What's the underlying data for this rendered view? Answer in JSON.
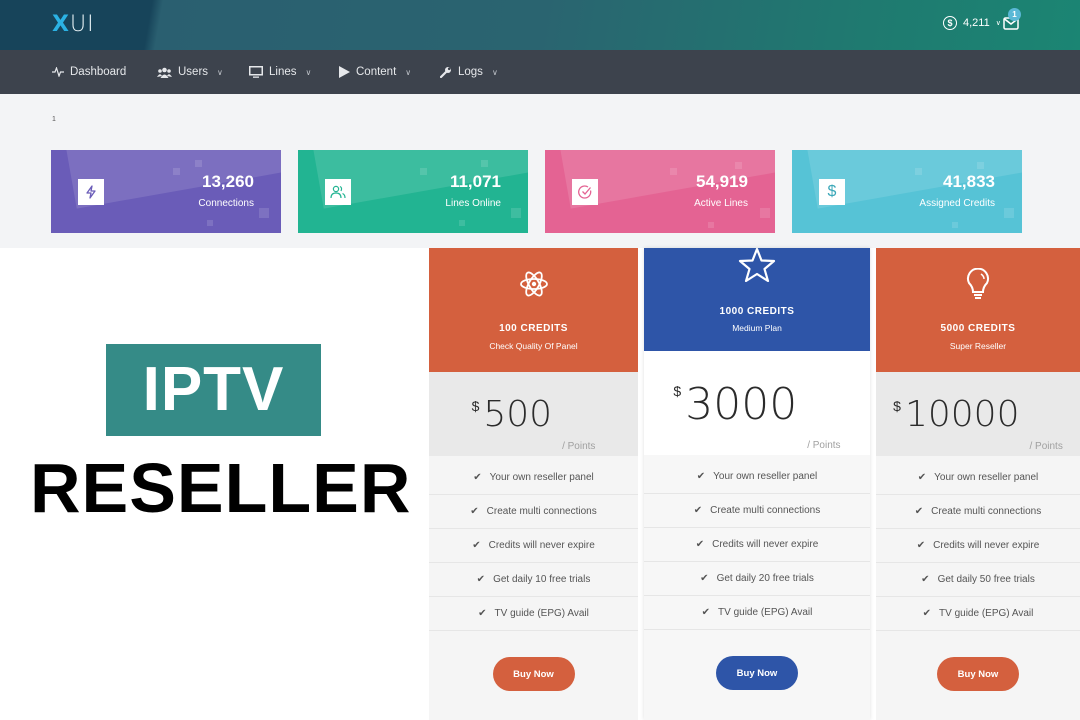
{
  "colors": {
    "orange": "#d4603e",
    "blue": "#2e55a8",
    "purple": "#6a5cb8",
    "green": "#22b492",
    "pink": "#e46393",
    "cyan": "#56c3d6",
    "teal_banner": "#358b87",
    "nav_bg": "#3d434d"
  },
  "header": {
    "logo_x": "X",
    "logo_rest": "UI",
    "credits_value": "4,211",
    "mail_badge": "1"
  },
  "nav": {
    "items": [
      {
        "label": "Dashboard",
        "icon": "activity-icon",
        "has_dropdown": false
      },
      {
        "label": "Users",
        "icon": "users-icon",
        "has_dropdown": true
      },
      {
        "label": "Lines",
        "icon": "monitor-icon",
        "has_dropdown": true
      },
      {
        "label": "Content",
        "icon": "play-icon",
        "has_dropdown": true
      },
      {
        "label": "Logs",
        "icon": "wrench-icon",
        "has_dropdown": true
      }
    ]
  },
  "breadcrumb_mark": "1",
  "stats": [
    {
      "value": "13,260",
      "label": "Connections",
      "icon": "lightning-icon"
    },
    {
      "value": "11,071",
      "label": "Lines Online",
      "icon": "users-icon"
    },
    {
      "value": "54,919",
      "label": "Active Lines",
      "icon": "check-circle-icon"
    },
    {
      "value": "41,833",
      "label": "Assigned Credits",
      "icon": "dollar-icon"
    }
  ],
  "banner": {
    "line1": "IPTV",
    "line2": "RESELLER"
  },
  "plans": [
    {
      "title": "100 CREDITS",
      "subtitle": "Check Quality Of Panel",
      "icon": "atom-icon",
      "currency": "$",
      "price": "500",
      "per": "/ Points",
      "features": [
        "Your own reseller panel",
        "Create multi connections",
        "Credits will never expire",
        "Get daily 10 free trials",
        "TV guide (EPG) Avail"
      ],
      "button": "Buy Now"
    },
    {
      "title": "1000 CREDITS",
      "subtitle": "Medium Plan",
      "icon": "star-icon",
      "currency": "$",
      "price": "3000",
      "per": "/ Points",
      "features": [
        "Your own reseller panel",
        "Create multi connections",
        "Credits will never expire",
        "Get daily 20 free trials",
        "TV guide (EPG) Avail"
      ],
      "button": "Buy Now"
    },
    {
      "title": "5000 CREDITS",
      "subtitle": "Super Reseller",
      "icon": "lightbulb-icon",
      "currency": "$",
      "price": "10000",
      "per": "/ Points",
      "features": [
        "Your own reseller panel",
        "Create multi connections",
        "Credits will never expire",
        "Get daily 50 free trials",
        "TV guide (EPG) Avail"
      ],
      "button": "Buy Now"
    }
  ]
}
